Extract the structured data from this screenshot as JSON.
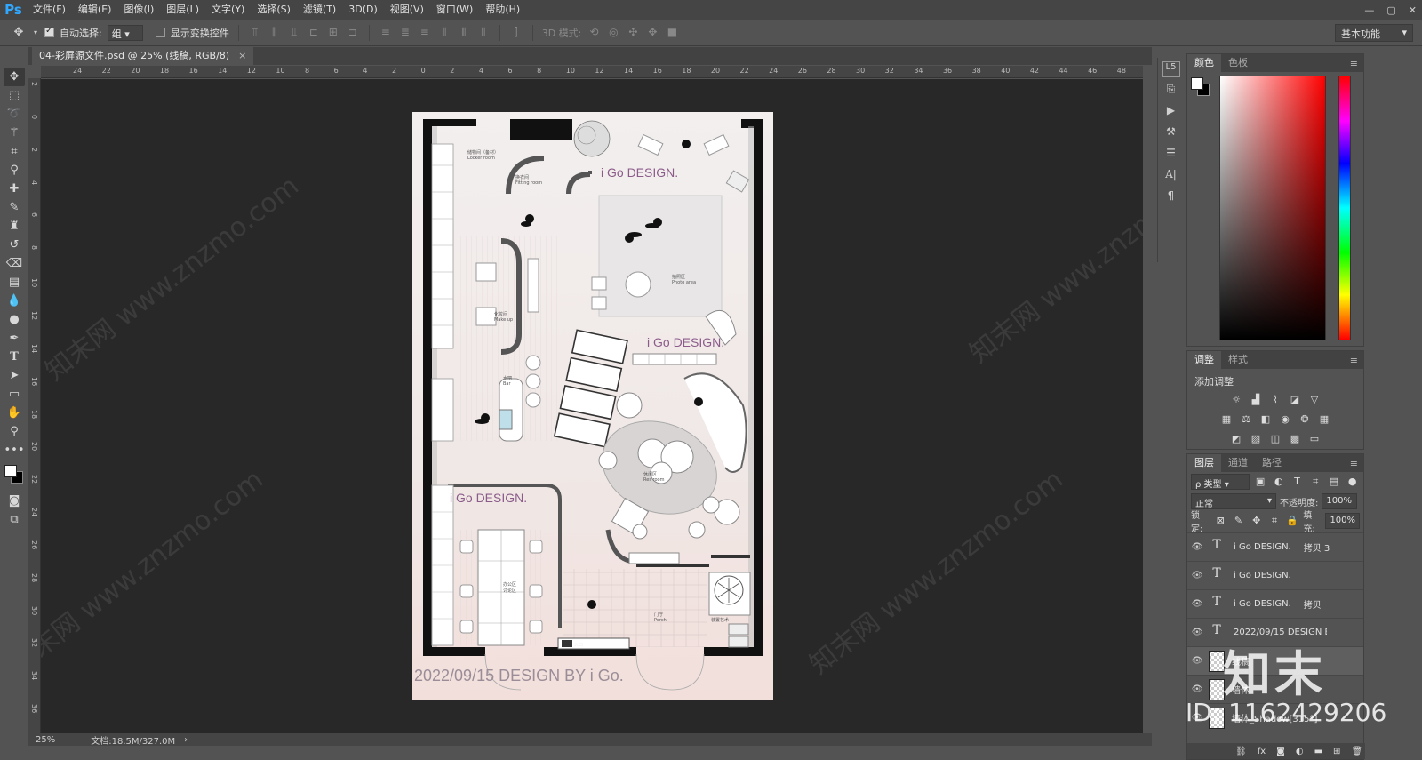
{
  "app": {
    "logo": "Ps"
  },
  "menu": [
    "文件(F)",
    "编辑(E)",
    "图像(I)",
    "图层(L)",
    "文字(Y)",
    "选择(S)",
    "滤镜(T)",
    "3D(D)",
    "视图(V)",
    "窗口(W)",
    "帮助(H)"
  ],
  "window_controls": [
    "—",
    "▢",
    "✕"
  ],
  "options": {
    "auto_select_label": "自动选择:",
    "auto_select_value": "组",
    "show_transform_label": "显示变换控件",
    "mode_3d_label": "3D 模式:",
    "workspace": "基本功能"
  },
  "document": {
    "tab_title": "04-彩屏源文件.psd @ 25% (线稿, RGB/8)",
    "zoom": "25%",
    "doc_size": "文档:18.5M/327.0M"
  },
  "ruler_top": [
    "24",
    "22",
    "20",
    "18",
    "16",
    "14",
    "12",
    "10",
    "8",
    "6",
    "4",
    "2",
    "0",
    "2",
    "4",
    "6",
    "8",
    "10",
    "12",
    "14",
    "16",
    "18",
    "20",
    "22",
    "24",
    "26",
    "28",
    "30",
    "32",
    "34",
    "36",
    "38",
    "40",
    "42",
    "44",
    "46",
    "48",
    "50"
  ],
  "ruler_left": [
    "2",
    "0",
    "2",
    "4",
    "6",
    "8",
    "10",
    "12",
    "14",
    "16",
    "18",
    "20",
    "22",
    "24",
    "26",
    "28",
    "30",
    "32",
    "34",
    "36"
  ],
  "plan": {
    "brand": "i Go DESIGN.",
    "footer": "2022/09/15 DESIGN BY i Go.",
    "rooms": {
      "locker": "储物间（备材）\nLocker room",
      "fitting": "换衣间\nFitting room",
      "photo": "拍照区\nPhoto area",
      "bar": "水吧\nBar",
      "makeup": "化妆间\nMake up",
      "rest": "休闲区\nRes room",
      "office": "办公区\n讨论区",
      "porch": "门厅\nPorch",
      "art": "装置艺术",
      "entrance": "入口"
    }
  },
  "panels": {
    "color_tabs": [
      "颜色",
      "色板"
    ],
    "adjust_tabs": [
      "调整",
      "样式"
    ],
    "adjust_title": "添加调整",
    "layers_tabs": [
      "图层",
      "通道",
      "路径"
    ],
    "kind_filter": "ρ 类型",
    "blend_mode": "正常",
    "opacity_label": "不透明度:",
    "opacity_value": "100%",
    "lock_label": "锁定:",
    "fill_label": "填充:",
    "fill_value": "100%",
    "layers": [
      {
        "name": "i Go DESIGN.",
        "suffix": "拷贝 3",
        "type": "text"
      },
      {
        "name": "i Go DESIGN.",
        "suffix": "",
        "type": "text"
      },
      {
        "name": "i Go DESIGN.",
        "suffix": "拷贝",
        "type": "text"
      },
      {
        "name": "2022/09/15 DESIGN BY i ...",
        "suffix": "",
        "type": "text"
      },
      {
        "name": "线稿",
        "suffix": "",
        "type": "pixel"
      },
      {
        "name": "墙体",
        "suffix": "",
        "type": "pixel"
      },
      {
        "name": "墙体_Shadow[315°]",
        "suffix": "",
        "type": "pixel"
      }
    ]
  },
  "overlay_watermark": {
    "brand": "知末",
    "id": "ID: 1162429206",
    "site": "知末网 www.znzmo.com"
  }
}
